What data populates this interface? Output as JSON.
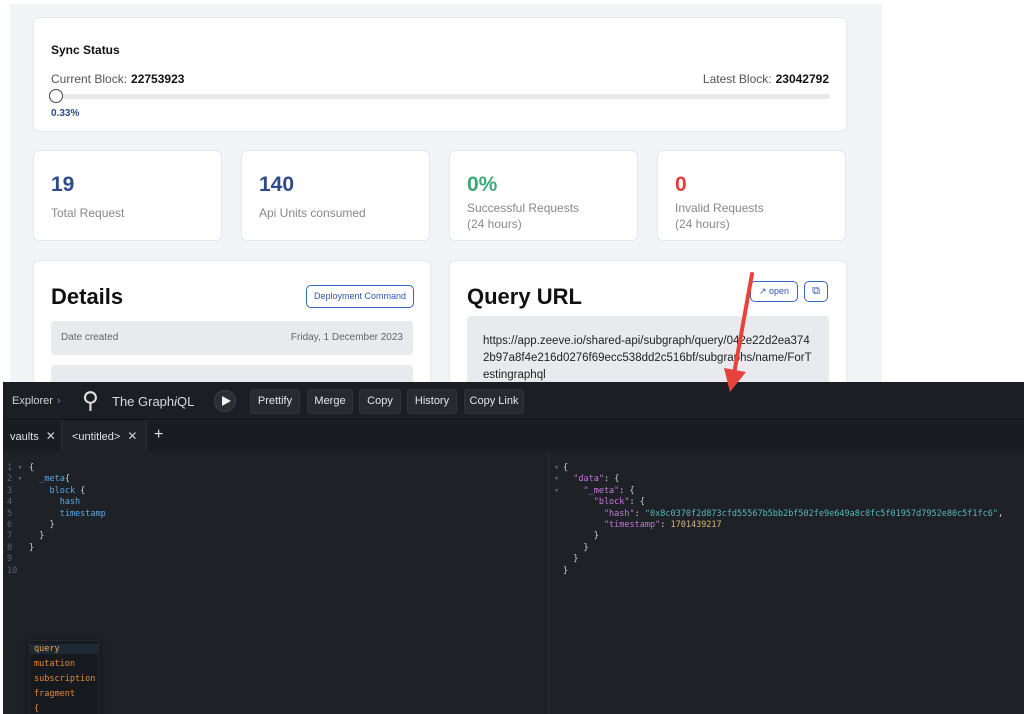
{
  "sync": {
    "title": "Sync Status",
    "current_label": "Current Block:",
    "current_value": "22753923",
    "latest_label": "Latest Block:",
    "latest_value": "23042792",
    "progress_percent": "0.33%"
  },
  "stats": [
    {
      "value": "19",
      "label": "Total Request",
      "color": "#2d4a8a"
    },
    {
      "value": "140",
      "label": "Api Units consumed",
      "color": "#2d4a8a"
    },
    {
      "value": "0%",
      "label": "Successful Requests",
      "sub": "(24 hours)",
      "color": "#3aa876"
    },
    {
      "value": "0",
      "label": "Invalid Requests",
      "sub": "(24 hours)",
      "color": "#e0403a"
    }
  ],
  "details": {
    "title": "Details",
    "deploy_button": "Deployment Command",
    "date_label": "Date created",
    "date_value": "Friday, 1 December 2023"
  },
  "query_url": {
    "title": "Query URL",
    "open_button": "open",
    "url": "https://app.zeeve.io/shared-api/subgraph/query/042e22d2ea3742b97a8f4e216d0276f69ecc538dd2c516bf/subgraphs/name/ForTestingraphql"
  },
  "graphiql": {
    "explorer_label": "Explorer",
    "brand_prefix": "The Graph",
    "brand_italic": "i",
    "brand_suffix": "QL",
    "buttons": {
      "prettify": "Prettify",
      "merge": "Merge",
      "copy": "Copy",
      "history": "History",
      "copy_link": "Copy Link"
    },
    "tabs": [
      {
        "label": "vaults"
      },
      {
        "label": "<untitled>"
      }
    ],
    "autocomplete": [
      "query",
      "mutation",
      "subscription",
      "fragment",
      "{"
    ]
  },
  "colors": {
    "primary": "#2d4a8a",
    "success": "#3aa876",
    "danger": "#e0403a",
    "arrow": "#e8423c"
  }
}
